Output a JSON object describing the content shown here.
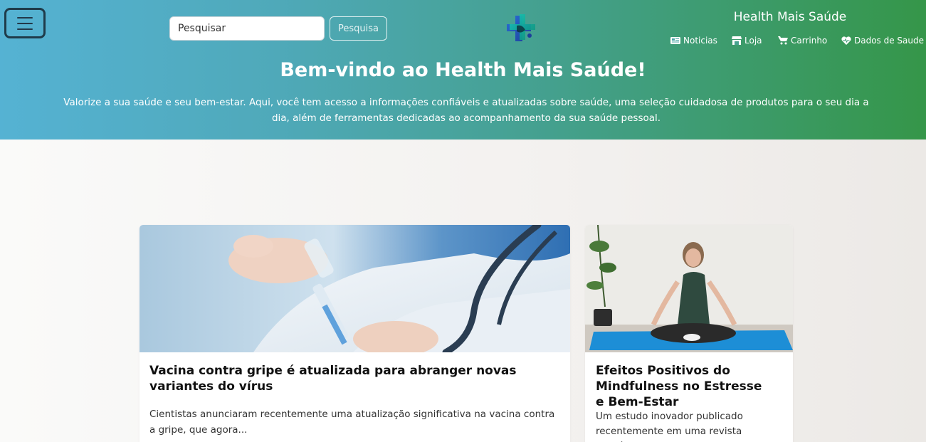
{
  "header": {
    "brand": "Health Mais Saúde",
    "search": {
      "placeholder": "Pesquisar",
      "button_label": "Pesquisa"
    },
    "nav": [
      {
        "label": "Noticias",
        "icon": "newspaper-icon"
      },
      {
        "label": "Loja",
        "icon": "store-icon"
      },
      {
        "label": "Carrinho",
        "icon": "cart-icon"
      },
      {
        "label": "Dados de Saude",
        "icon": "heart-pulse-icon"
      }
    ],
    "gradient": {
      "start": "#55b2d3",
      "end": "#359649"
    }
  },
  "hero": {
    "title": "Bem-vindo ao Health Mais Saúde!",
    "text": "Valorize a sua saúde e seu bem-estar. Aqui, você tem acesso a informações confiáveis e atualizadas sobre saúde, uma seleção cuidadosa de produtos para o seu dia a dia, além de ferramentas dedicadas ao acompanhamento da sua saúde pessoal."
  },
  "articles": [
    {
      "title": "Vacina contra gripe é atualizada para abranger novas variantes do vírus",
      "excerpt": "Cientistas anunciaram recentemente uma atualização significativa na vacina contra a gripe, que agora...",
      "image": "vaccine-syringe-photo"
    },
    {
      "title": "Efeitos Positivos do Mindfulness no Estresse e Bem-Estar",
      "excerpt": "Um estudo inovador publicado recentemente em uma revista científica",
      "image": "meditation-yoga-photo"
    }
  ]
}
